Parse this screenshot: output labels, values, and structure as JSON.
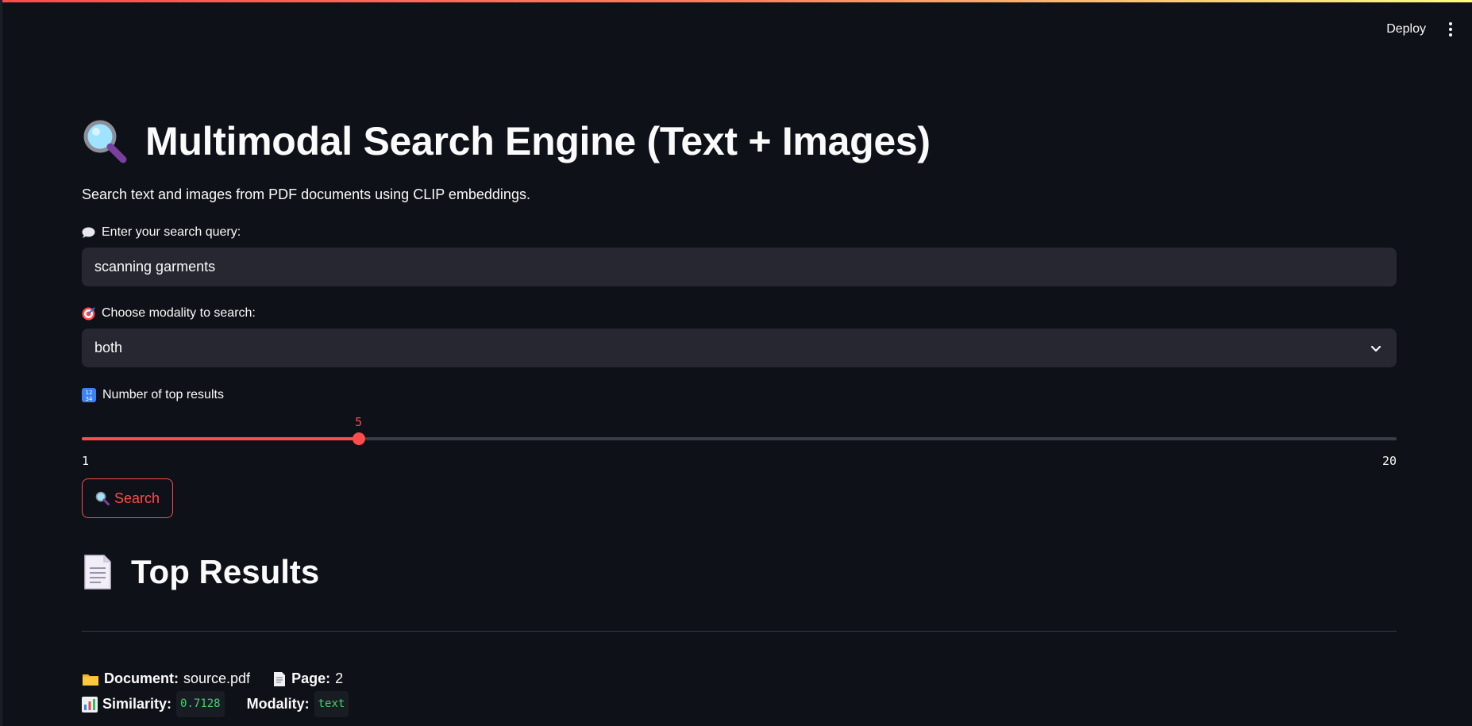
{
  "toolbar": {
    "deploy_label": "Deploy",
    "menu_icon": "kebab-icon"
  },
  "header": {
    "title_icon": "magnifier-icon",
    "title": "Multimodal Search Engine (Text + Images)",
    "subtitle": "Search text and images from PDF documents using CLIP embeddings."
  },
  "query_field": {
    "label_icon": "speech-bubble-icon",
    "label": "Enter your search query:",
    "value": "scanning garments"
  },
  "modality_field": {
    "label_icon": "target-icon",
    "label": "Choose modality to search:",
    "selected": "both"
  },
  "topk_slider": {
    "label_icon": "numbers-icon",
    "label": "Number of top results",
    "value": 5,
    "min": 1,
    "max": 20,
    "accent": "#ff4b4b"
  },
  "search_button": {
    "icon": "magnifier-icon",
    "label": "Search"
  },
  "results": {
    "heading_icon": "document-icon",
    "heading": "Top Results",
    "first": {
      "document_key": "Document:",
      "document_value": "source.pdf",
      "page_key": "Page:",
      "page_value": "2",
      "similarity_key": "Similarity:",
      "similarity_value": "0.7128",
      "modality_key": "Modality:",
      "modality_value": "text"
    }
  }
}
